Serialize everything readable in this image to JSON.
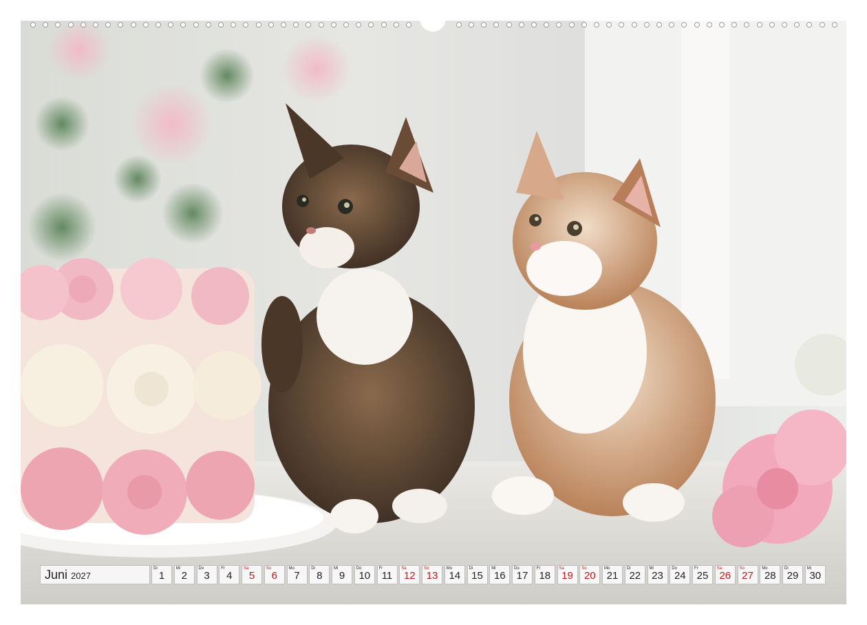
{
  "calendar": {
    "month": "Juni",
    "year": "2027",
    "days": [
      {
        "wd": "Di",
        "d": "1",
        "weekend": false
      },
      {
        "wd": "Mi",
        "d": "2",
        "weekend": false
      },
      {
        "wd": "Do",
        "d": "3",
        "weekend": false
      },
      {
        "wd": "Fr",
        "d": "4",
        "weekend": false
      },
      {
        "wd": "Sa",
        "d": "5",
        "weekend": true
      },
      {
        "wd": "So",
        "d": "6",
        "weekend": true
      },
      {
        "wd": "Mo",
        "d": "7",
        "weekend": false
      },
      {
        "wd": "Di",
        "d": "8",
        "weekend": false
      },
      {
        "wd": "Mi",
        "d": "9",
        "weekend": false
      },
      {
        "wd": "Do",
        "d": "10",
        "weekend": false
      },
      {
        "wd": "Fr",
        "d": "11",
        "weekend": false
      },
      {
        "wd": "Sa",
        "d": "12",
        "weekend": true
      },
      {
        "wd": "So",
        "d": "13",
        "weekend": true
      },
      {
        "wd": "Mo",
        "d": "14",
        "weekend": false
      },
      {
        "wd": "Di",
        "d": "15",
        "weekend": false
      },
      {
        "wd": "Mi",
        "d": "16",
        "weekend": false
      },
      {
        "wd": "Do",
        "d": "17",
        "weekend": false
      },
      {
        "wd": "Fr",
        "d": "18",
        "weekend": false
      },
      {
        "wd": "Sa",
        "d": "19",
        "weekend": true
      },
      {
        "wd": "So",
        "d": "20",
        "weekend": true
      },
      {
        "wd": "Mo",
        "d": "21",
        "weekend": false
      },
      {
        "wd": "Di",
        "d": "22",
        "weekend": false
      },
      {
        "wd": "Mi",
        "d": "23",
        "weekend": false
      },
      {
        "wd": "Do",
        "d": "24",
        "weekend": false
      },
      {
        "wd": "Fr",
        "d": "25",
        "weekend": false
      },
      {
        "wd": "Sa",
        "d": "26",
        "weekend": true
      },
      {
        "wd": "So",
        "d": "27",
        "weekend": true
      },
      {
        "wd": "Mo",
        "d": "28",
        "weekend": false
      },
      {
        "wd": "Di",
        "d": "29",
        "weekend": false
      },
      {
        "wd": "Mi",
        "d": "30",
        "weekend": false
      }
    ]
  },
  "colors": {
    "weekend": "#c01818",
    "weekday": "#222222"
  }
}
